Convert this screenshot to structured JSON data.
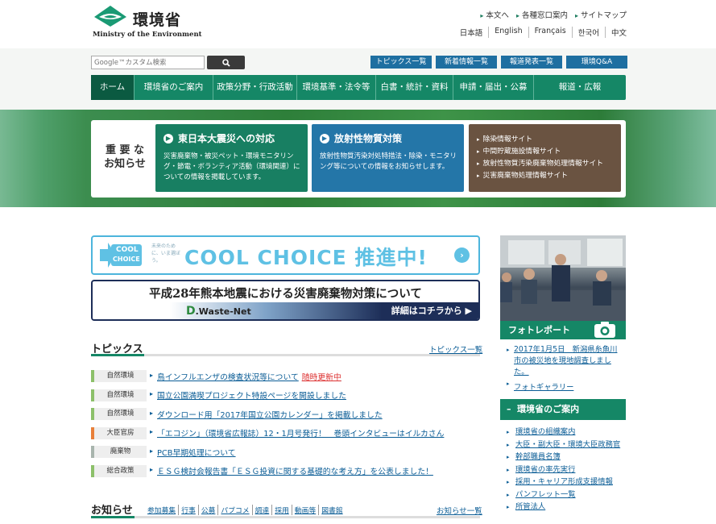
{
  "header": {
    "logo_ja": "環境省",
    "logo_en": "Ministry of the Environment",
    "util_links": [
      "本文へ",
      "各種窓口案内",
      "サイトマップ"
    ],
    "lang_links": [
      "日本語",
      "English",
      "Français",
      "한국어",
      "中文"
    ]
  },
  "search": {
    "placeholder": "Google™カスタム検索"
  },
  "quick_links": [
    "トピックス一覧",
    "新着情報一覧",
    "報道発表一覧",
    "環境Q&A"
  ],
  "nav": [
    "ホーム",
    "環境省のご案内",
    "政策分野・行政活動",
    "環境基準・法令等",
    "白書・統計・資料",
    "申請・届出・公募",
    "報道・広報"
  ],
  "hero": {
    "label": "重 要 な\nお知らせ",
    "quake": {
      "title": "東日本大震災への対応",
      "desc": "災害廃棄物・被災ペット・環境モニタリング・節電・ボランティア活動（環境関連）についての情報を掲載しています。"
    },
    "radiation": {
      "title": "放射性物質対策",
      "desc": "放射性物質汚染対処特措法・除染・モニタリング等についての情報をお知らせします。"
    },
    "sites": [
      "除染情報サイト",
      "中間貯蔵施設情報サイト",
      "放射性物質汚染廃棄物処理情報サイト",
      "災害廃棄物処理情報サイト"
    ]
  },
  "banners": {
    "cool_choice_text": "COOL CHOICE 推進中!",
    "cool_choice_logo_top": "COOL",
    "cool_choice_logo_bottom": "CHOICE",
    "cool_choice_small": "未来のために、いま選ぼう。",
    "waste_title": "平成28年熊本地震における災害廃棄物対策について",
    "waste_logo_d": "D",
    "waste_logo": ".Waste-Net",
    "waste_more": "詳細はコチラから ▶"
  },
  "topics": {
    "heading": "トピックス",
    "more": "トピックス一覧",
    "items": [
      {
        "tag": "自然環境",
        "text": "鳥インフルエンザの検査状況等について",
        "new": "随時更新中",
        "color": "#8cc06a"
      },
      {
        "tag": "自然環境",
        "text": "国立公園満喫プロジェクト特設ページを開設しました",
        "new": "",
        "color": "#8cc06a"
      },
      {
        "tag": "自然環境",
        "text": "ダウンロード用「2017年国立公園カレンダー」を掲載しました",
        "new": "",
        "color": "#8cc06a"
      },
      {
        "tag": "大臣官房",
        "text": "「エコジン」（環境省広報誌）12・1月号発行！　巻頭インタビューはイルカさん",
        "new": "",
        "color": "#e8803a"
      },
      {
        "tag": "廃棄物",
        "text": "PCB早期処理について",
        "new": "",
        "color": "#a8b4ad"
      },
      {
        "tag": "総合政策",
        "text": "ＥＳＧ検討会報告書「ＥＳＧ投資に関する基礎的な考え方」を公表しました！",
        "new": "",
        "color": "#8cc06a"
      }
    ]
  },
  "notices": {
    "heading": "お知らせ",
    "categories": [
      "参加募集",
      "行事",
      "公募",
      "パブコメ",
      "調達",
      "採用",
      "動画等",
      "図書館"
    ],
    "more": "お知らせ一覧"
  },
  "photo": {
    "title": "フォトレポート",
    "report": "2017年1月5日　新潟県糸魚川市の被災地を現地調査しました。",
    "gallery": "フォトギャラリー"
  },
  "guide": {
    "title": "環境省のご案内",
    "items": [
      "環境省の組織案内",
      "大臣・副大臣・環境大臣政務官",
      "幹部職員名簿",
      "環境省の率先実行",
      "採用・キャリア形成支援情報",
      "パンフレット一覧",
      "所管法人"
    ]
  }
}
